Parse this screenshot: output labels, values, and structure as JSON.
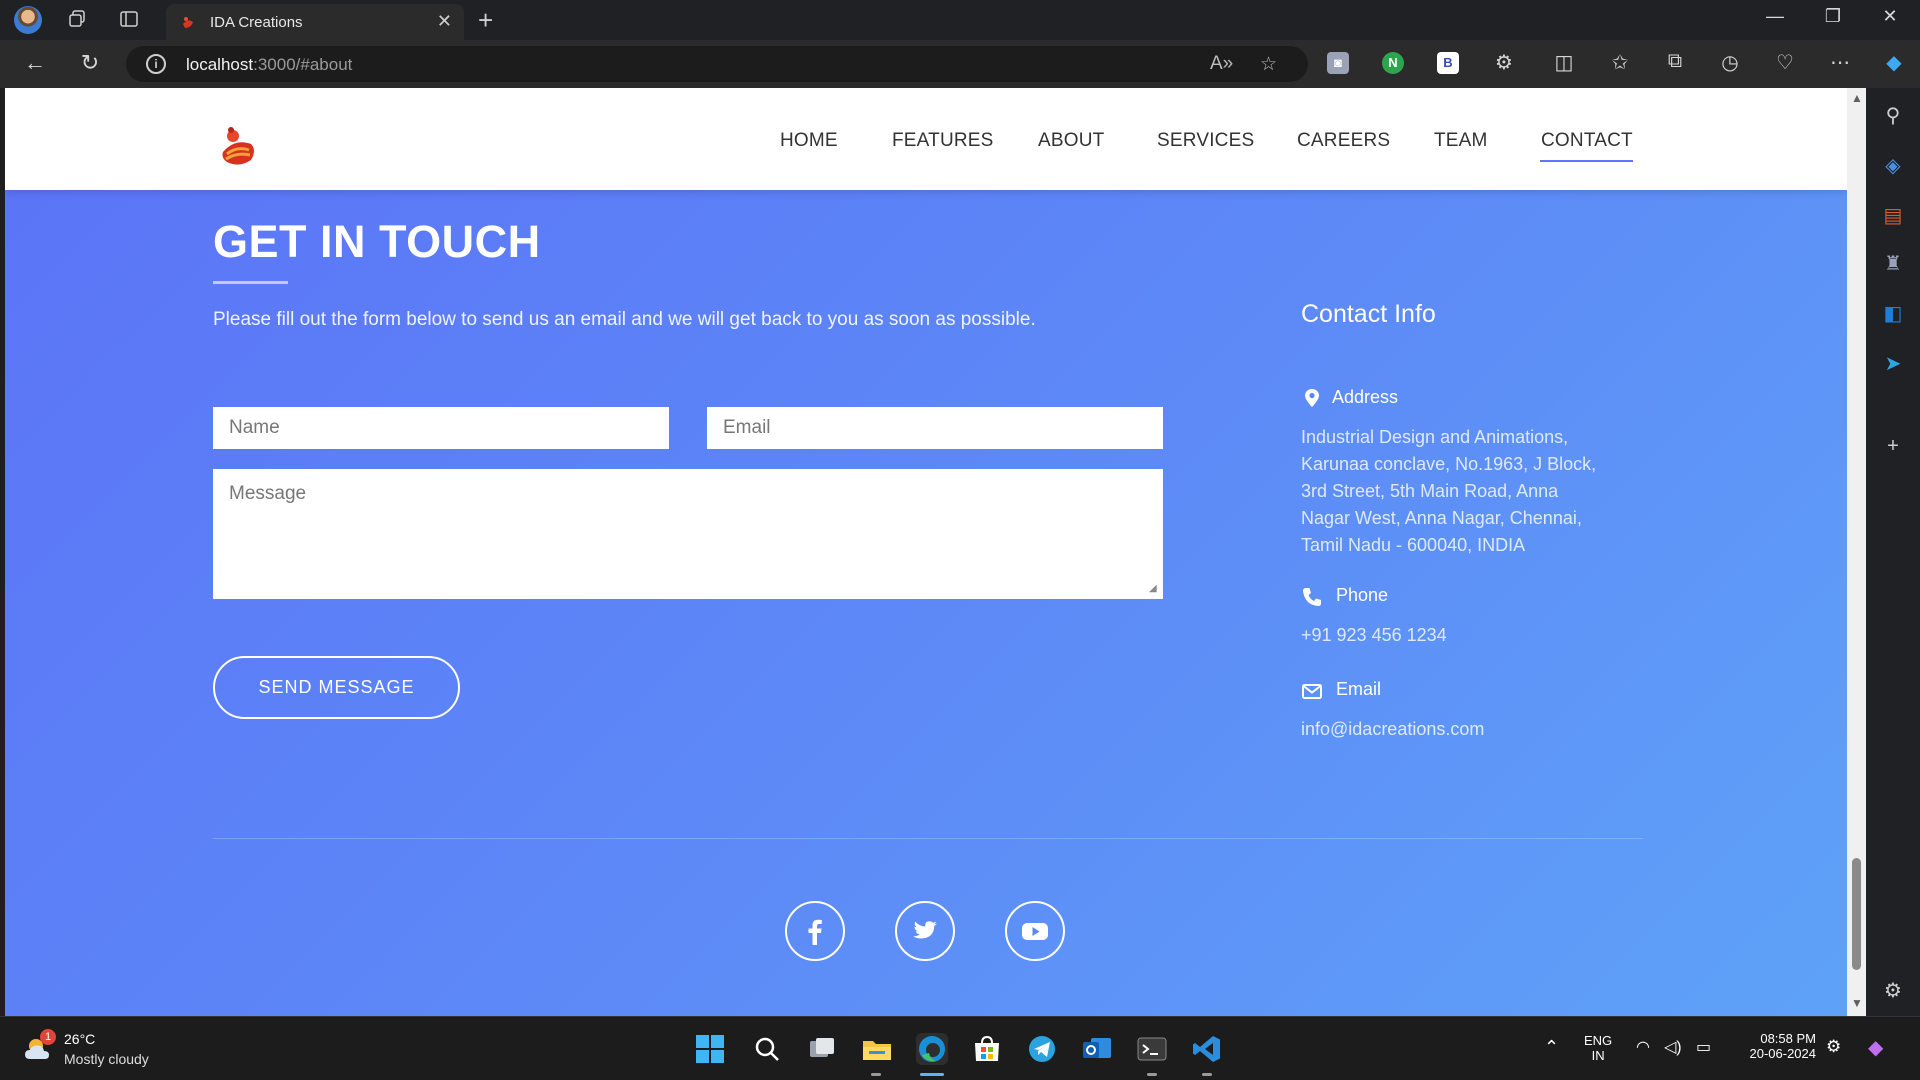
{
  "browser": {
    "tab_title": "IDA Creations",
    "url_host": "localhost",
    "url_rest": ":3000/#about"
  },
  "site": {
    "nav": [
      "HOME",
      "FEATURES",
      "ABOUT",
      "SERVICES",
      "CAREERS",
      "TEAM",
      "CONTACT"
    ],
    "active_nav": "CONTACT"
  },
  "contact": {
    "title": "GET IN TOUCH",
    "subtitle": "Please fill out the form below to send us an email and we will get back to you as soon as possible.",
    "name_placeholder": "Name",
    "email_placeholder": "Email",
    "message_placeholder": "Message",
    "send_label": "SEND MESSAGE"
  },
  "contact_info": {
    "title": "Contact Info",
    "address_label": "Address",
    "address_lines": [
      "Industrial Design and Animations,",
      "Karunaa conclave, No.1963, J Block,",
      "3rd Street, 5th Main Road, Anna",
      "Nagar West, Anna Nagar, Chennai,",
      "Tamil Nadu - 600040, INDIA"
    ],
    "phone_label": "Phone",
    "phone": "+91 923 456 1234",
    "email_label": "Email",
    "email": "info@idacreations.com"
  },
  "social": [
    "facebook-icon",
    "twitter-icon",
    "youtube-icon"
  ],
  "taskbar": {
    "weather_badge": "1",
    "weather_temp": "26°C",
    "weather_desc": "Mostly cloudy",
    "lang_top": "ENG",
    "lang_bottom": "IN",
    "time": "08:58 PM",
    "date": "20-06-2024"
  },
  "colors": {
    "gradient_start": "#5b73f7",
    "gradient_end": "#5ea2f8",
    "nav_underline": "#6372ff"
  }
}
